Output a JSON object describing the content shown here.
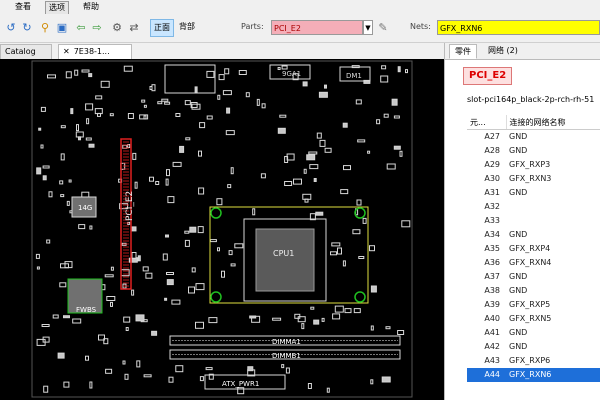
{
  "menu": {
    "items": [
      "查看",
      "选项",
      "帮助"
    ],
    "active_index": 1
  },
  "toolbar": {
    "mode_on": "正面",
    "mode_off": "背部",
    "parts_label": "Parts:",
    "parts_value": "PCI_E2",
    "nets_label": "Nets:",
    "nets_value": "GFX_RXN6"
  },
  "doc_tabs": {
    "catalog": "Catalog",
    "file": "7E38-1..."
  },
  "right_tabs": {
    "part": "零件",
    "net": "网络 (2)"
  },
  "selected_part": {
    "name": "PCI_E2",
    "description": "slot-pci164p_black-2p-rch-rh-51"
  },
  "pin_table": {
    "headers": [
      "元...",
      "连接的网络名称"
    ],
    "rows": [
      {
        "pin": "A27",
        "net": "GND"
      },
      {
        "pin": "A28",
        "net": "GND"
      },
      {
        "pin": "A29",
        "net": "GFX_RXP3"
      },
      {
        "pin": "A30",
        "net": "GFX_RXN3"
      },
      {
        "pin": "A31",
        "net": "GND"
      },
      {
        "pin": "A32",
        "net": ""
      },
      {
        "pin": "A33",
        "net": ""
      },
      {
        "pin": "A34",
        "net": "GND"
      },
      {
        "pin": "A35",
        "net": "GFX_RXP4"
      },
      {
        "pin": "A36",
        "net": "GFX_RXN4"
      },
      {
        "pin": "A37",
        "net": "GND"
      },
      {
        "pin": "A38",
        "net": "GND"
      },
      {
        "pin": "A39",
        "net": "GFX_RXP5"
      },
      {
        "pin": "A40",
        "net": "GFX_RXN5"
      },
      {
        "pin": "A41",
        "net": "GND"
      },
      {
        "pin": "A42",
        "net": "GND"
      },
      {
        "pin": "A43",
        "net": "GFX_RXP6"
      },
      {
        "pin": "A44",
        "net": "GFX_RXN6"
      }
    ],
    "selected_index": 17
  },
  "board": {
    "labels": {
      "pci_e2": "PCI_E2",
      "cpu": "CPU1",
      "dimm_a1": "DIMMA1",
      "dimm_b1": "DIMMB1",
      "atx": "ATX_PWR1",
      "chip_14g": "14G",
      "chip_fwbs": "FWBS",
      "top_mid": "9GA1",
      "top_right": "DM1"
    },
    "colors": {
      "background": "#000000",
      "silk": "#d8d8d8",
      "highlight_slot": "#e02020",
      "cpu_outline": "#e0e040",
      "mounting_ring": "#20c020",
      "chip_fill": "#707070"
    }
  }
}
